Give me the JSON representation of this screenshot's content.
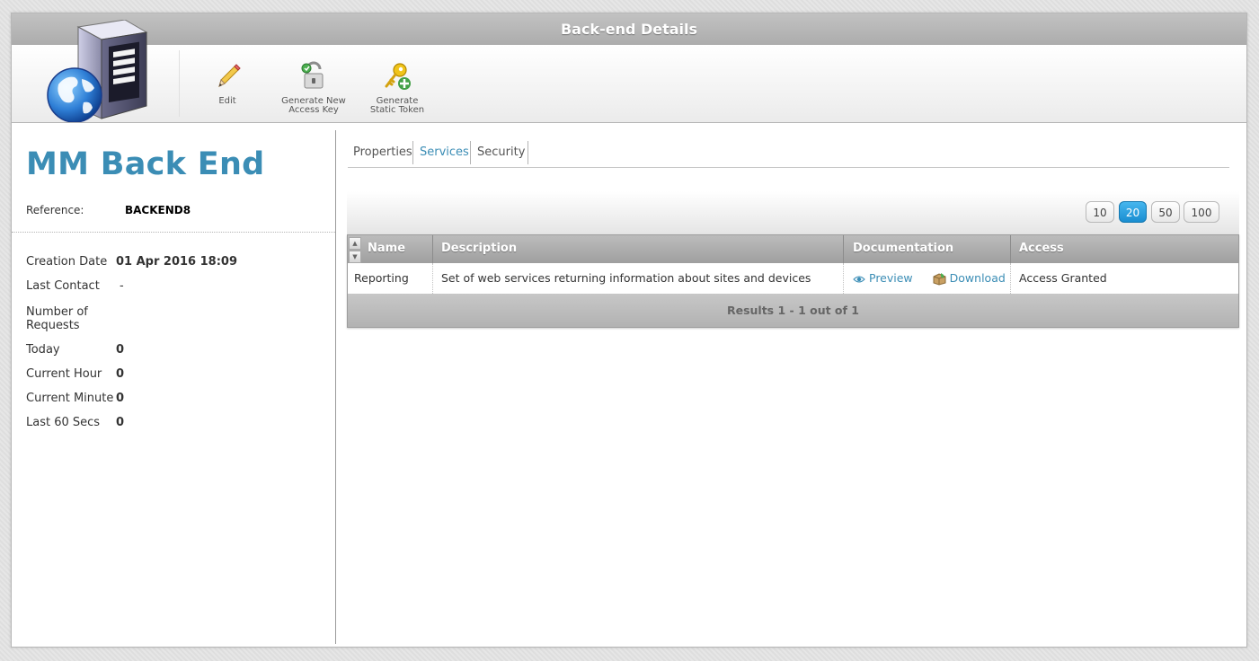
{
  "window": {
    "title": "Back-end Details"
  },
  "toolbar": {
    "edit_label": "Edit",
    "gen_key_line1": "Generate New",
    "gen_key_line2": "Access Key",
    "gen_token_line1": "Generate",
    "gen_token_line2": "Static Token"
  },
  "backend": {
    "name": "MM Back End",
    "reference_label": "Reference:",
    "reference_value": "BACKEND8"
  },
  "stats": {
    "creation_label": "Creation Date",
    "creation_value": "01 Apr 2016 18:09",
    "last_contact_label": "Last Contact",
    "last_contact_value": "-",
    "requests_label_1": "Number of",
    "requests_label_2": "Requests",
    "today_label": "Today",
    "today_value": "0",
    "hour_label": "Current Hour",
    "hour_value": "0",
    "minute_label": "Current Minute",
    "minute_value": "0",
    "last60_label": "Last 60 Secs",
    "last60_value": "0"
  },
  "tabs": [
    "Properties",
    "Services",
    "Security"
  ],
  "active_tab": "Services",
  "pagination": {
    "options": [
      "10",
      "20",
      "50",
      "100"
    ],
    "selected": "20"
  },
  "grid": {
    "columns": [
      "Name",
      "Description",
      "Documentation",
      "Access"
    ],
    "rows": [
      {
        "name": "Reporting",
        "description": "Set of web services returning information about sites and devices",
        "preview": "Preview",
        "download": "Download",
        "access": "Access Granted"
      }
    ],
    "footer": "Results 1 - 1 out of 1"
  },
  "colors": {
    "accent": "#3b8db5",
    "selected_page": "#1a8ed1"
  },
  "icons": [
    "server-globe-icon",
    "pencil-icon",
    "padlock-icon",
    "key-plus-icon",
    "eye-icon",
    "package-icon",
    "sort-arrows-icon"
  ]
}
